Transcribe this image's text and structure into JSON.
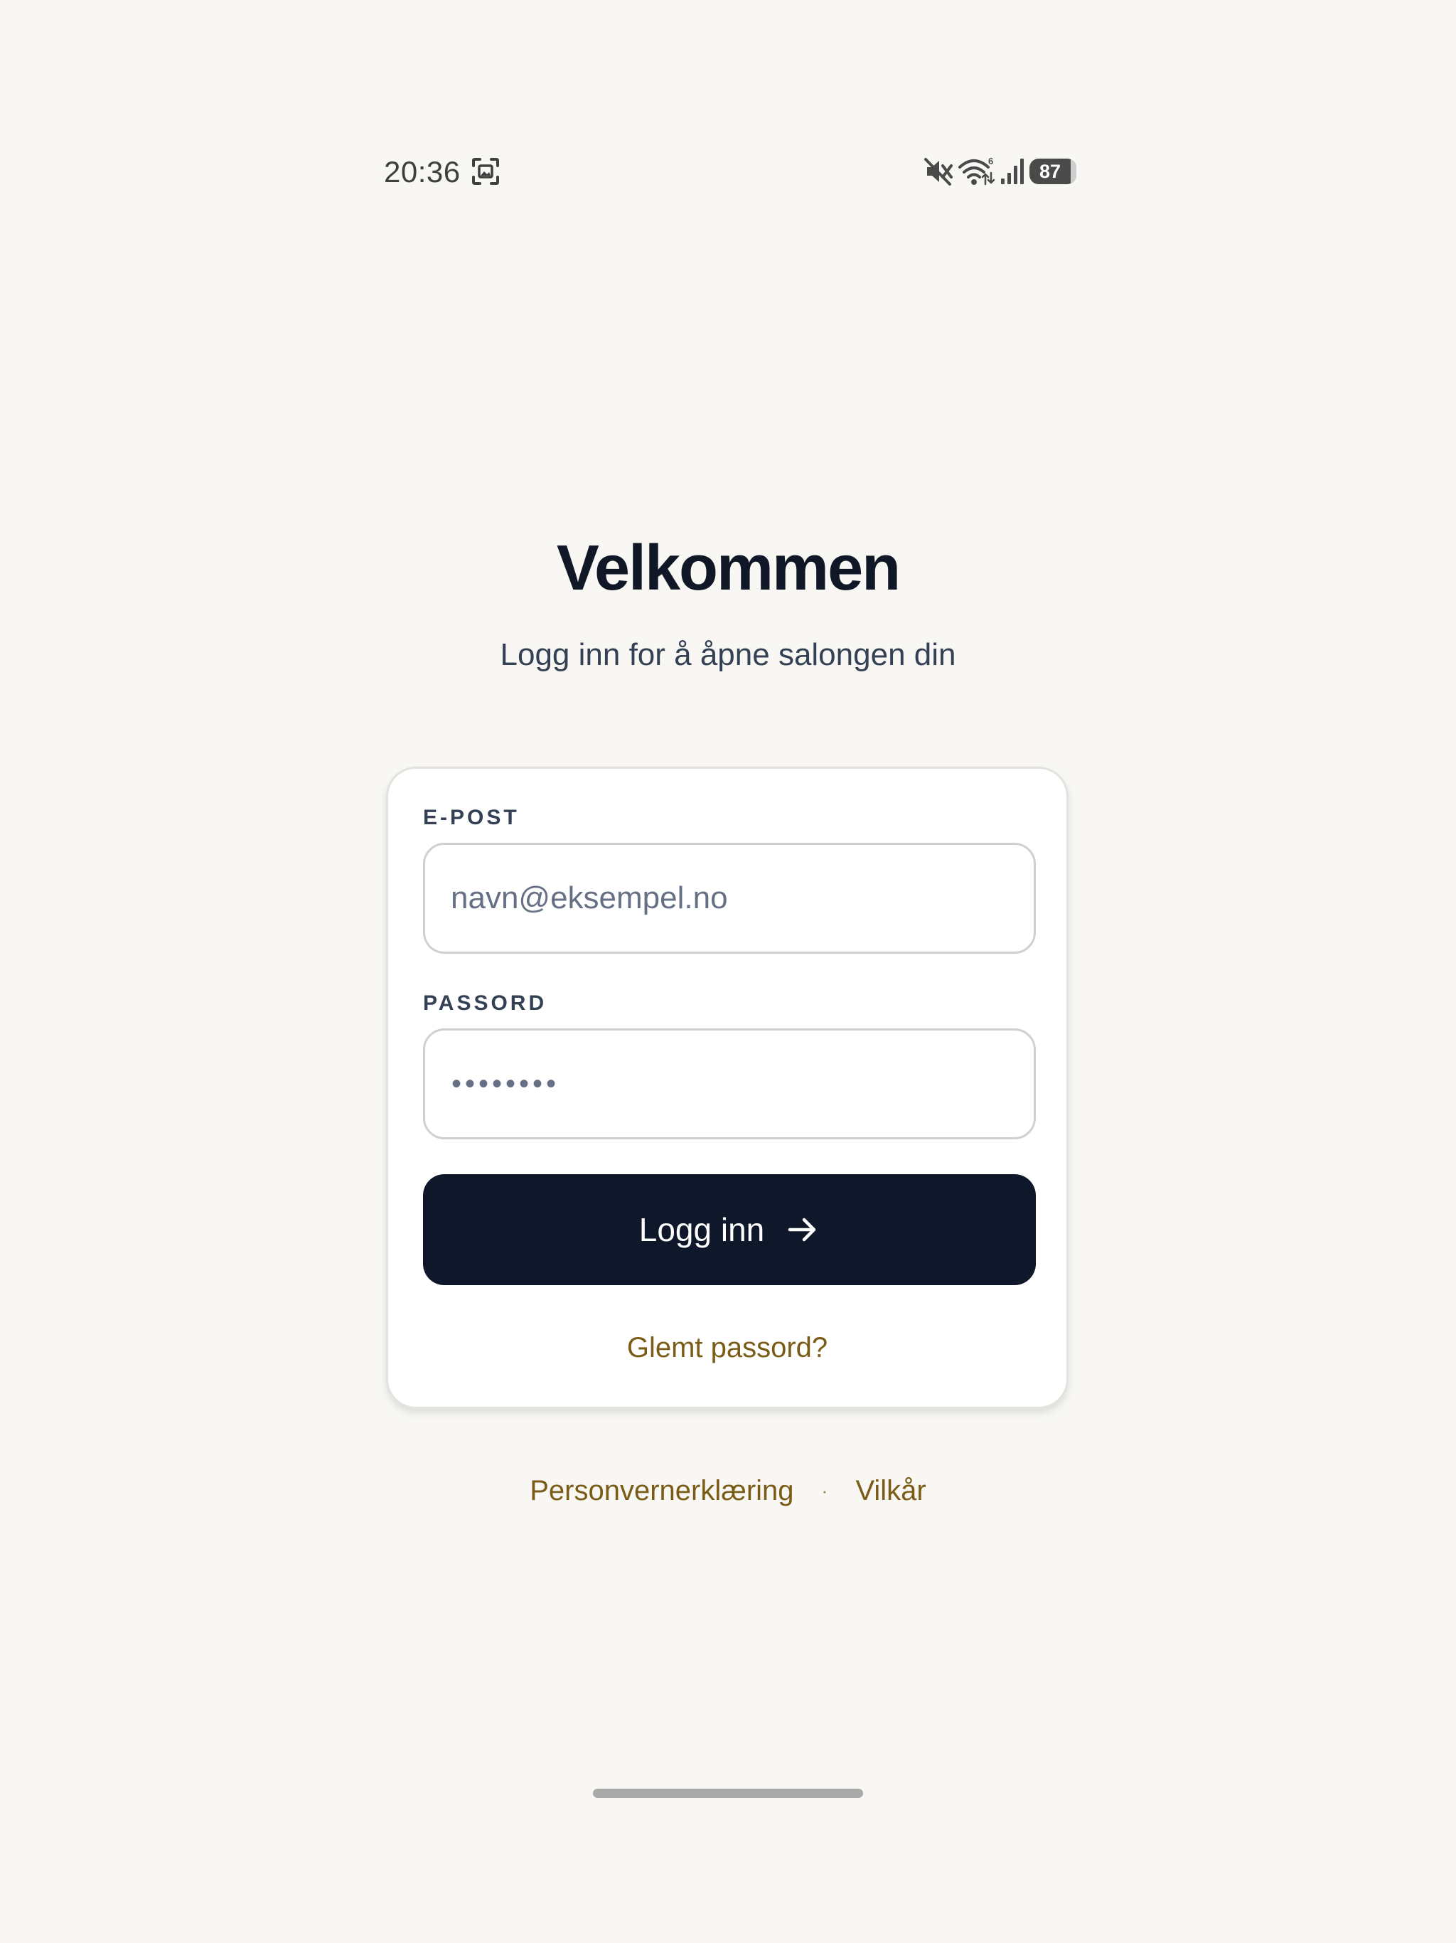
{
  "status_bar": {
    "time": "20:36",
    "battery_level": "87",
    "icons": [
      "screenshot-icon",
      "mute-icon",
      "wifi-6-icon",
      "signal-icon",
      "battery-icon"
    ]
  },
  "header": {
    "title": "Velkommen",
    "subtitle": "Logg inn for å åpne salongen din"
  },
  "login_form": {
    "email_label": "E-POST",
    "email_placeholder": "navn@eksempel.no",
    "email_value": "",
    "password_label": "PASSORD",
    "password_mask": "••••••••",
    "submit_label": "Logg inn",
    "submit_icon": "arrow-right-icon",
    "forgot_password_label": "Glemt passord?"
  },
  "footer": {
    "privacy_label": "Personvernerklæring",
    "separator": "·",
    "terms_label": "Vilkår"
  },
  "colors": {
    "background": "#f8f7f3",
    "primary": "#0f172a",
    "accent_link": "#7a5c17",
    "heading": "#101828",
    "muted_text": "#667085"
  }
}
